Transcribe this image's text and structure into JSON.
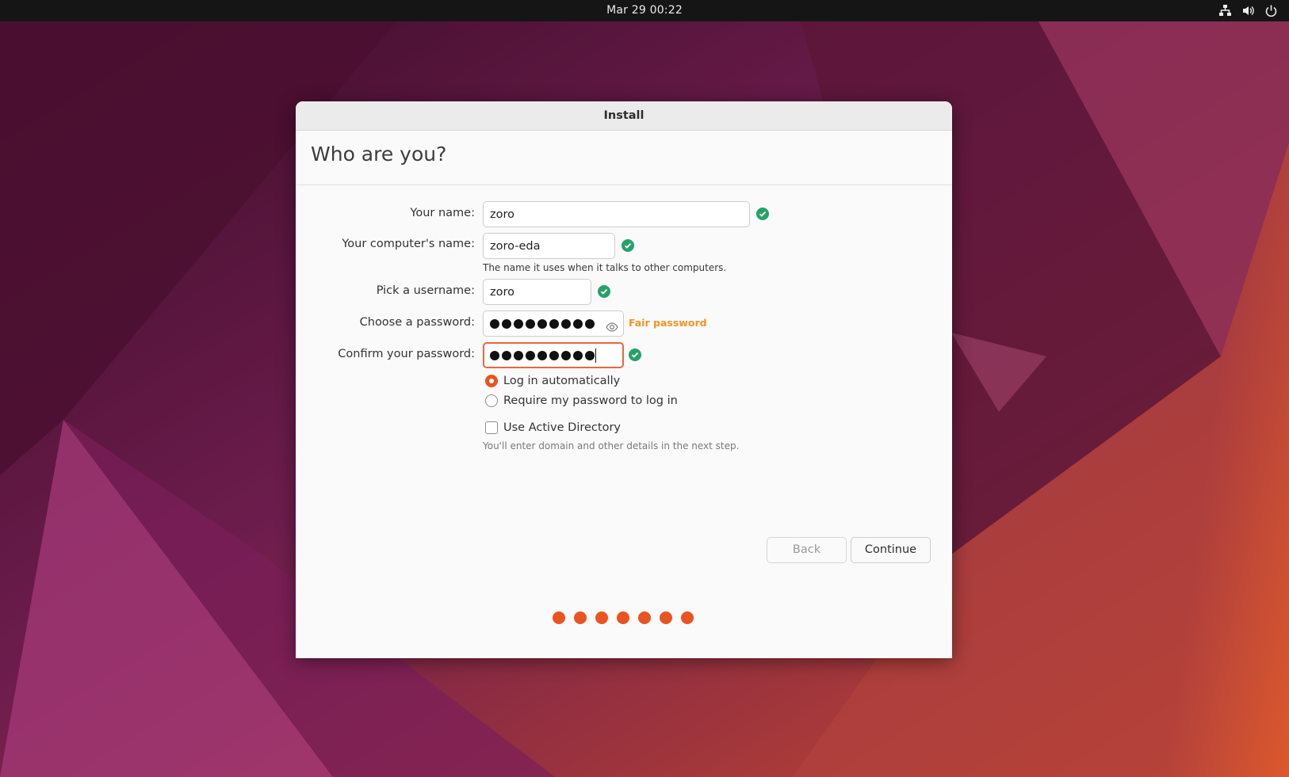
{
  "topbar": {
    "datetime": "Mar 29  00:22",
    "icons": [
      "network-icon",
      "volume-icon",
      "power-icon"
    ]
  },
  "window": {
    "title": "Install",
    "heading": "Who are you?"
  },
  "form": {
    "name_label": "Your name:",
    "name_value": "zoro",
    "computer_label": "Your computer's name:",
    "computer_value": "zoro-eda",
    "computer_hint": "The name it uses when it talks to other computers.",
    "username_label": "Pick a username:",
    "username_value": "zoro",
    "password_label": "Choose a password:",
    "password_masked_length": 9,
    "password_strength": "Fair password",
    "confirm_label": "Confirm your password:",
    "confirm_masked_length": 9,
    "login_options": [
      {
        "label": "Log in automatically",
        "selected": true
      },
      {
        "label": "Require my password to log in",
        "selected": false
      }
    ],
    "active_directory_label": "Use Active Directory",
    "active_directory_checked": false,
    "active_directory_hint": "You'll enter domain and other details in the next step."
  },
  "buttons": {
    "back": "Back",
    "continue": "Continue"
  },
  "progress": {
    "total_steps": 7,
    "completed_steps": 7
  },
  "colors": {
    "accent": "#e95420",
    "success": "#26a269",
    "warning": "#f29423",
    "topbar": "#151515"
  }
}
